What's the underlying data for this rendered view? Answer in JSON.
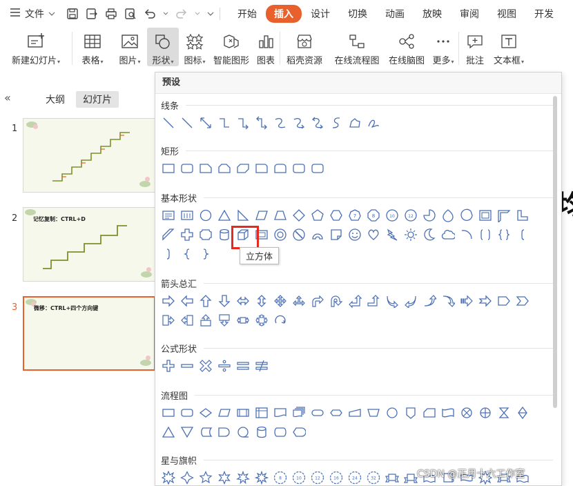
{
  "menubar": {
    "file_label": "文件",
    "tabs": [
      "开始",
      "插入",
      "设计",
      "切换",
      "动画",
      "放映",
      "审阅",
      "视图",
      "开发"
    ],
    "active_tab": "插入"
  },
  "ribbon": {
    "new_slide": "新建幻灯片",
    "table": "表格",
    "picture": "图片",
    "shape": "形状",
    "icon": "图标",
    "smart_graphic": "智能图形",
    "chart": "图表",
    "daoke": "稻壳资源",
    "flowchart": "在线流程图",
    "mindmap": "在线脑图",
    "more": "更多",
    "comment": "批注",
    "textbox": "文本框"
  },
  "leftpanel": {
    "collapse_glyph": "«",
    "view_outline": "大纲",
    "view_slides": "幻灯片",
    "slides": [
      {
        "num": "1",
        "title": ""
      },
      {
        "num": "2",
        "title": "记忆复制：CTRL+D"
      },
      {
        "num": "3",
        "title": "微移：CTRL+四个方向键"
      }
    ],
    "current_slide": "3"
  },
  "shape_panel": {
    "header": "预设",
    "sections": {
      "lines": "线条",
      "rect": "矩形",
      "basic": "基本形状",
      "arrows": "箭头总汇",
      "formula": "公式形状",
      "flow": "流程图",
      "stars": "星与旗帜"
    },
    "tooltip": "立方体"
  },
  "peek_glyph": "均",
  "watermark": "CSDN @正月十六工作室",
  "colors": {
    "accent": "#e8612c",
    "shape_stroke": "#4a6fb5",
    "highlight": "#e52a1e"
  }
}
